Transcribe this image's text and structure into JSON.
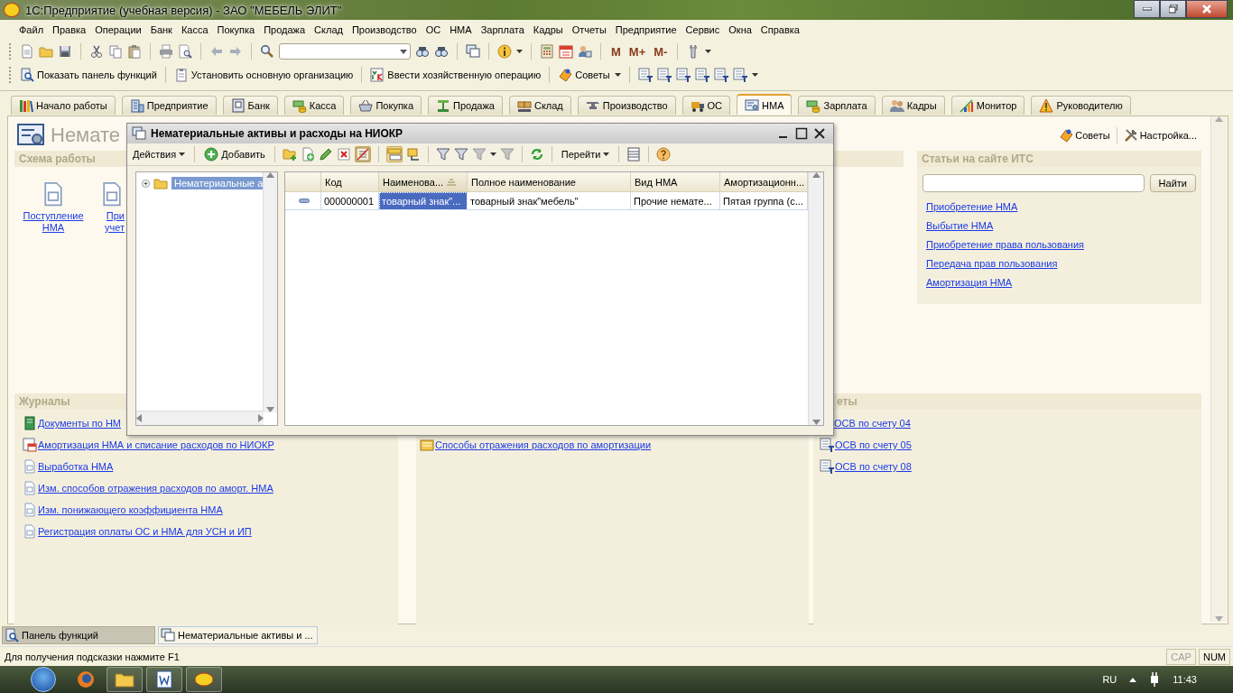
{
  "window": {
    "title": "1С:Предприятие (учебная версия) - ЗАО \"МЕБЕЛЬ ЭЛИТ\""
  },
  "menu": [
    "Файл",
    "Правка",
    "Операции",
    "Банк",
    "Касса",
    "Покупка",
    "Продажа",
    "Склад",
    "Производство",
    "ОС",
    "НМА",
    "Зарплата",
    "Кадры",
    "Отчеты",
    "Предприятие",
    "Сервис",
    "Окна",
    "Справка"
  ],
  "toolbar": {
    "memory_buttons": [
      "M",
      "M+",
      "M-"
    ]
  },
  "command_bar": [
    "Показать панель функций",
    "Установить основную организацию",
    "Ввести хозяйственную операцию",
    "Советы"
  ],
  "tabs": [
    {
      "label": "Начало работы",
      "selected": false
    },
    {
      "label": "Предприятие",
      "selected": false
    },
    {
      "label": "Банк",
      "selected": false
    },
    {
      "label": "Касса",
      "selected": false
    },
    {
      "label": "Покупка",
      "selected": false
    },
    {
      "label": "Продажа",
      "selected": false
    },
    {
      "label": "Склад",
      "selected": false
    },
    {
      "label": "Производство",
      "selected": false
    },
    {
      "label": "ОС",
      "selected": false
    },
    {
      "label": "НМА",
      "selected": true
    },
    {
      "label": "Зарплата",
      "selected": false
    },
    {
      "label": "Кадры",
      "selected": false
    },
    {
      "label": "Монитор",
      "selected": false
    },
    {
      "label": "Руководителю",
      "selected": false
    }
  ],
  "panel": {
    "title": "Немате",
    "actions": [
      "Советы",
      "Настройка..."
    ],
    "scheme": {
      "title": "Схема работы",
      "links": [
        "Поступление НМА",
        "При учет"
      ]
    },
    "its": {
      "title": "Статьи на сайте ИТС",
      "search_button": "Найти",
      "links": [
        "Приобретение НМА",
        "Выбытие НМА",
        "Приобретение права пользования",
        "Передача прав пользования",
        "Амортизация НМА"
      ]
    },
    "journals": {
      "title": "Журналы",
      "links": [
        "Документы по НМ",
        "Амортизация НМА и списание расходов по НИОКР",
        "Выработка НМА",
        "Изм. способов отражения расходов по аморт. НМА",
        "Изм. понижающего коэффициента НМА",
        "Регистрация оплаты ОС и НМА для УСН и ИП"
      ]
    },
    "middle": {
      "links": [
        "Способы отражения расходов по амортизации"
      ]
    },
    "reports": {
      "title": "еты",
      "links": [
        "ОСВ по счету 04",
        "ОСВ по счету 05",
        "ОСВ по счету 08"
      ]
    }
  },
  "dialog": {
    "title": "Нематериальные активы и расходы на НИОКР",
    "actions_menu": "Действия",
    "add_button": "Добавить",
    "goto_menu": "Перейти",
    "tree": [
      {
        "label": "Нематериальные а",
        "selected": true,
        "expanded": false
      }
    ],
    "table": {
      "columns": [
        {
          "label": "Код",
          "sorted": false
        },
        {
          "label": "Наименова...",
          "sorted": true
        },
        {
          "label": "Полное наименование",
          "sorted": false
        },
        {
          "label": "Вид НМА",
          "sorted": false
        },
        {
          "label": "Амортизационн...",
          "sorted": false
        }
      ],
      "rows": [
        {
          "cells": [
            {
              "text": "000000001",
              "selected": false
            },
            {
              "text": "товарный знак\"...",
              "selected": true
            },
            {
              "text": "товарный знак\"мебель\"",
              "selected": false
            },
            {
              "text": "Прочие немате...",
              "selected": false
            },
            {
              "text": "Пятая группа (с...",
              "selected": false
            }
          ]
        }
      ]
    }
  },
  "window_list": [
    {
      "label": "Панель функций",
      "selected": false
    },
    {
      "label": "Нематериальные активы и ...",
      "selected": true
    }
  ],
  "status_bar": {
    "hint": "Для получения подсказки нажмите F1",
    "indicators": [
      {
        "label": "CAP",
        "on": false
      },
      {
        "label": "NUM",
        "on": true
      }
    ]
  },
  "taskbar": {
    "language": "RU",
    "time": "11:43"
  }
}
